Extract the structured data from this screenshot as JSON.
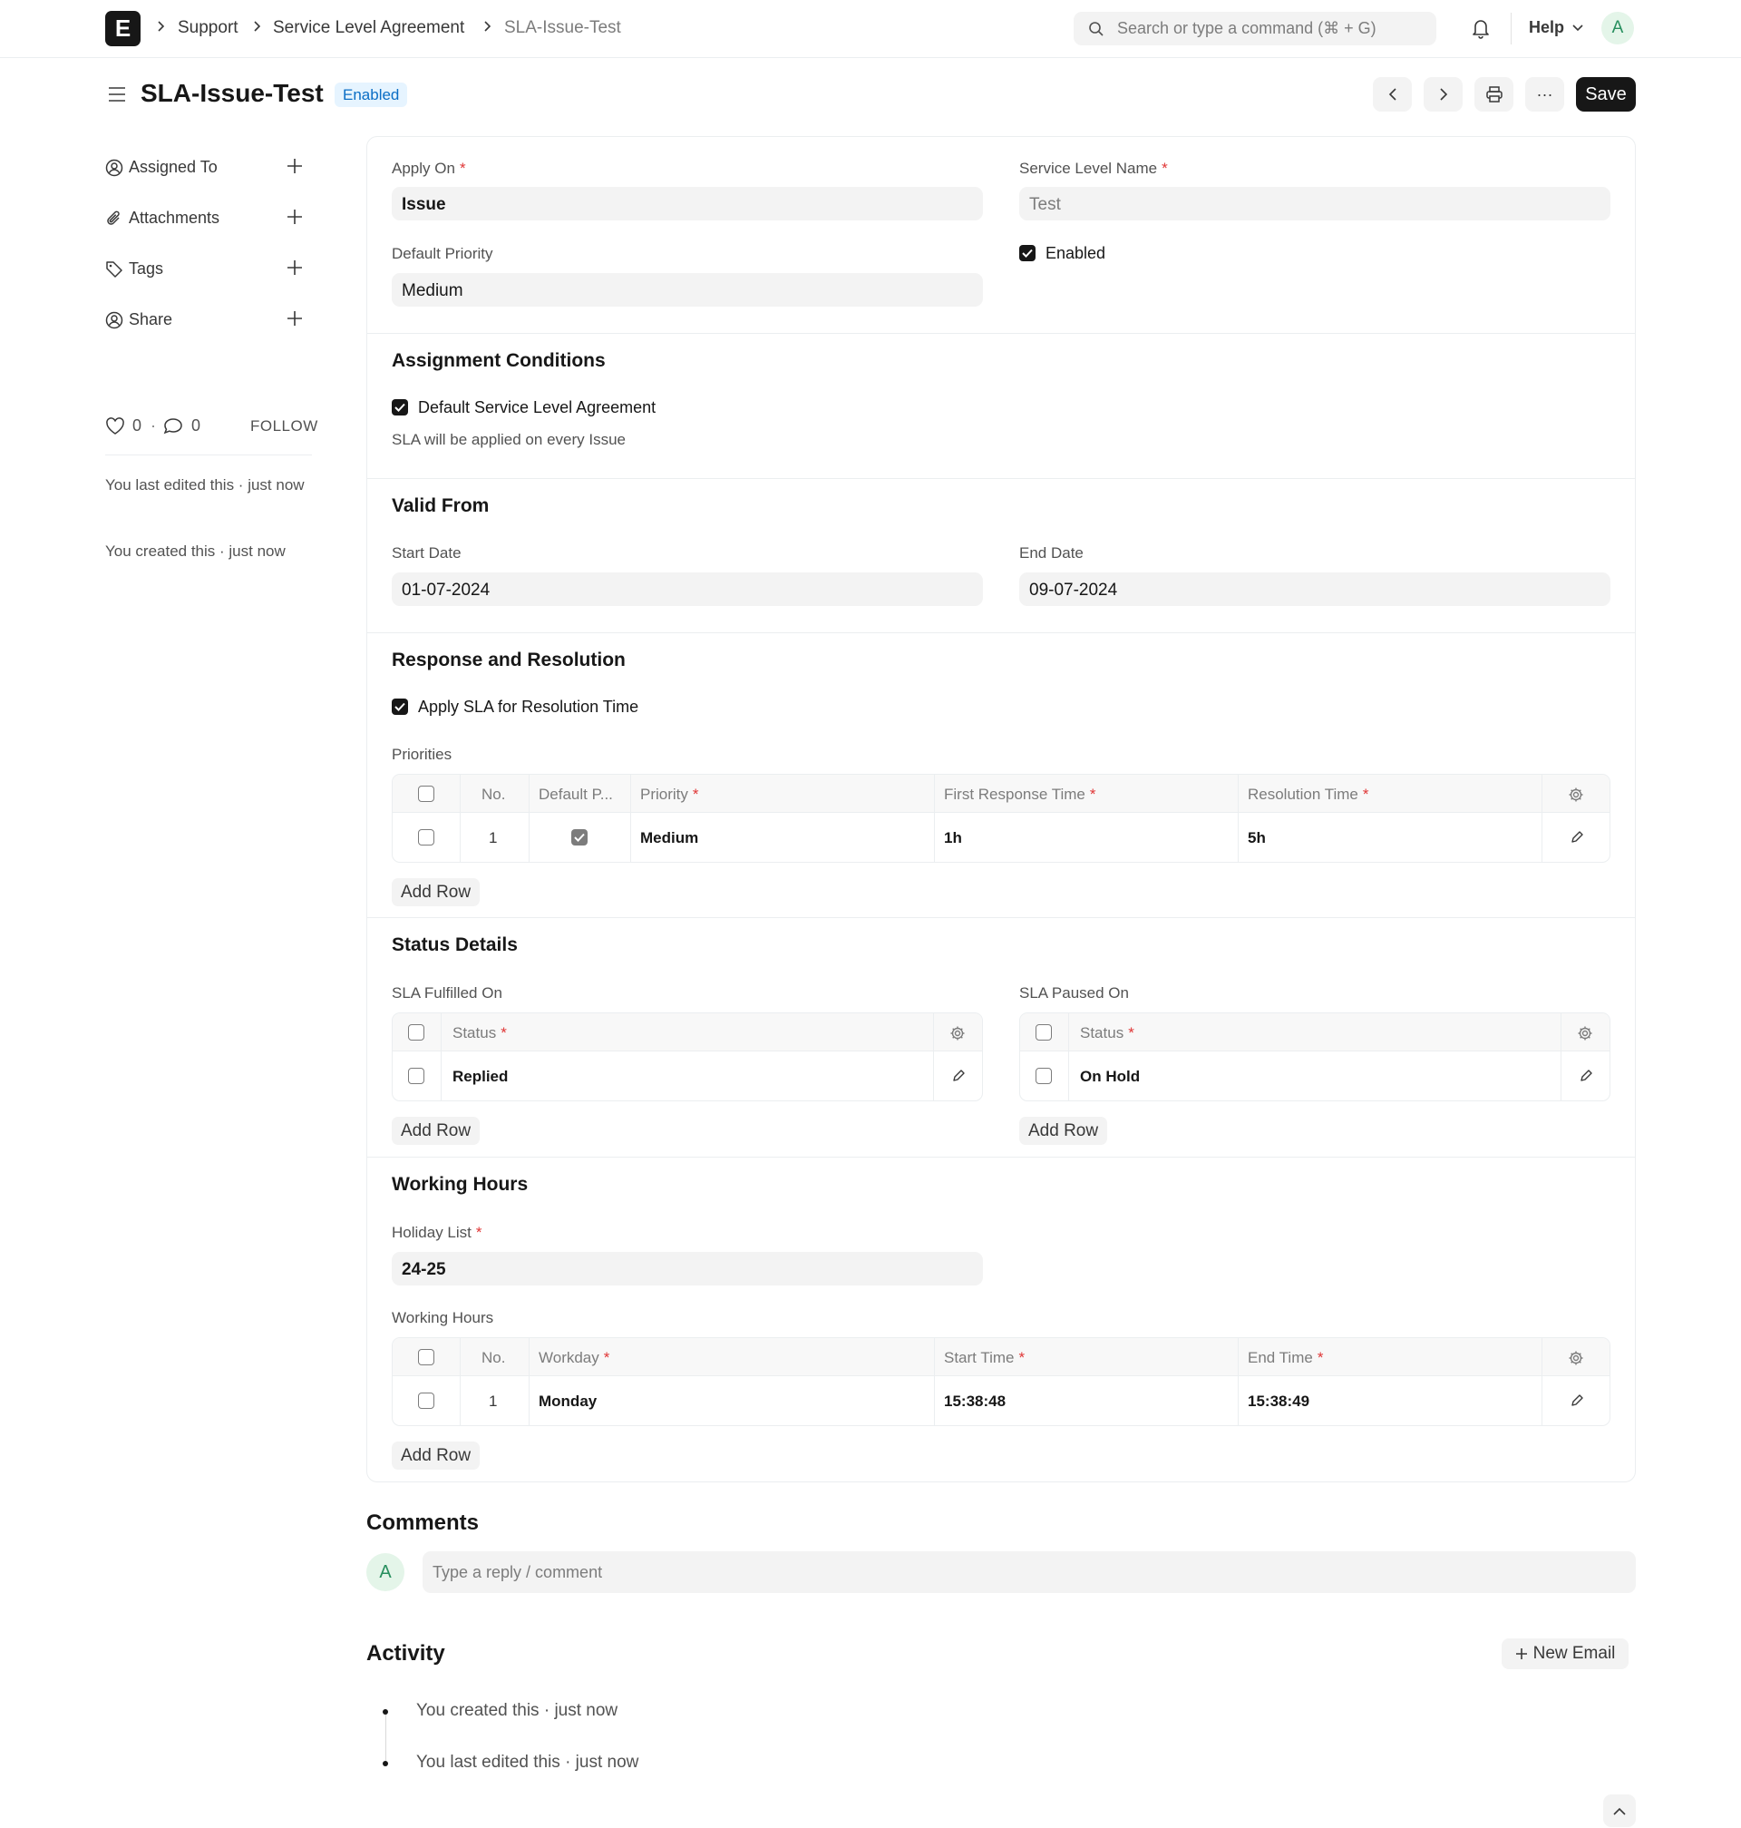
{
  "navbar": {
    "logo_letter": "E",
    "breadcrumbs": [
      "Support",
      "Service Level Agreement",
      "SLA-Issue-Test"
    ],
    "search_placeholder": "Search or type a command (⌘ + G)",
    "help_label": "Help",
    "avatar_initial": "A"
  },
  "page": {
    "title": "SLA-Issue-Test",
    "status_badge": "Enabled",
    "save_label": "Save",
    "more_label": "···"
  },
  "sidebar": {
    "items": [
      {
        "label": "Assigned To",
        "icon": "assign-icon"
      },
      {
        "label": "Attachments",
        "icon": "paperclip-icon"
      },
      {
        "label": "Tags",
        "icon": "tag-icon"
      },
      {
        "label": "Share",
        "icon": "share-icon"
      }
    ],
    "likes": "0",
    "comments": "0",
    "follow_label": "FOLLOW",
    "last_edited": "You last edited this · just now",
    "created": "You created this · just now"
  },
  "form": {
    "apply_on": {
      "label": "Apply On",
      "value": "Issue"
    },
    "service_level_name": {
      "label": "Service Level Name",
      "value": "Test"
    },
    "default_priority": {
      "label": "Default Priority",
      "value": "Medium"
    },
    "enabled": {
      "label": "Enabled",
      "checked": true
    },
    "assignment": {
      "title": "Assignment Conditions",
      "default_sla_label": "Default Service Level Agreement",
      "help": "SLA will be applied on every Issue"
    },
    "valid_from": {
      "title": "Valid From",
      "start_label": "Start Date",
      "start_value": "01-07-2024",
      "end_label": "End Date",
      "end_value": "09-07-2024"
    },
    "response": {
      "title": "Response and Resolution",
      "apply_sla_label": "Apply SLA for Resolution Time",
      "priorities_label": "Priorities",
      "headers": {
        "no": "No.",
        "default": "Default P...",
        "priority": "Priority",
        "first_response": "First Response Time",
        "resolution": "Resolution Time"
      },
      "rows": [
        {
          "no": "1",
          "default": true,
          "priority": "Medium",
          "first_response": "1h",
          "resolution": "5h"
        }
      ],
      "add_row": "Add Row"
    },
    "status": {
      "title": "Status Details",
      "fulfilled_label": "SLA Fulfilled On",
      "fulfilled_header": "Status",
      "fulfilled_rows": [
        "Replied"
      ],
      "paused_label": "SLA Paused On",
      "paused_header": "Status",
      "paused_rows": [
        "On Hold"
      ],
      "add_row": "Add Row"
    },
    "working": {
      "title": "Working Hours",
      "holiday_label": "Holiday List",
      "holiday_value": "24-25",
      "table_label": "Working Hours",
      "headers": {
        "no": "No.",
        "workday": "Workday",
        "start": "Start Time",
        "end": "End Time"
      },
      "rows": [
        {
          "no": "1",
          "workday": "Monday",
          "start": "15:38:48",
          "end": "15:38:49"
        }
      ],
      "add_row": "Add Row"
    }
  },
  "comments": {
    "title": "Comments",
    "avatar_initial": "A",
    "placeholder": "Type a reply / comment"
  },
  "activity": {
    "title": "Activity",
    "new_email_label": "New Email",
    "items": [
      "You created this · just now",
      "You last edited this · just now"
    ]
  }
}
